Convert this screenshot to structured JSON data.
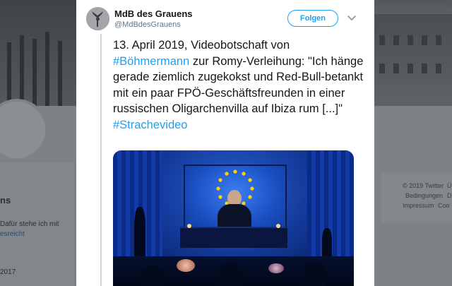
{
  "background": {
    "left_profile_lines": [
      "ns",
      "Dafür stehe ich mit",
      "esreicht",
      "2017"
    ],
    "footer_links": [
      "© 2019 Twitter",
      "Ü",
      "Bedingungen",
      "D",
      "Impressum",
      "Coo"
    ]
  },
  "tweet": {
    "author_name": "MdB des Grauens",
    "author_handle": "@MdBdesGrauens",
    "follow_label": "Folgen",
    "text_part1": "13. April 2019, Videobotschaft von ",
    "hashtag1": "#Böhmermann",
    "text_part2": " zur Romy-Verleihung: \"Ich hänge gerade ziemlich zugekokst und Red-Bull-betankt mit ein paar FPÖ-Geschäftsfreunden in einer russischen Oligarchenvilla auf Ibiza rum [...]\" ",
    "hashtag2": "#Strachevideo",
    "link_color": "#1da1f2",
    "icons": [
      "chevron-down-icon"
    ]
  }
}
